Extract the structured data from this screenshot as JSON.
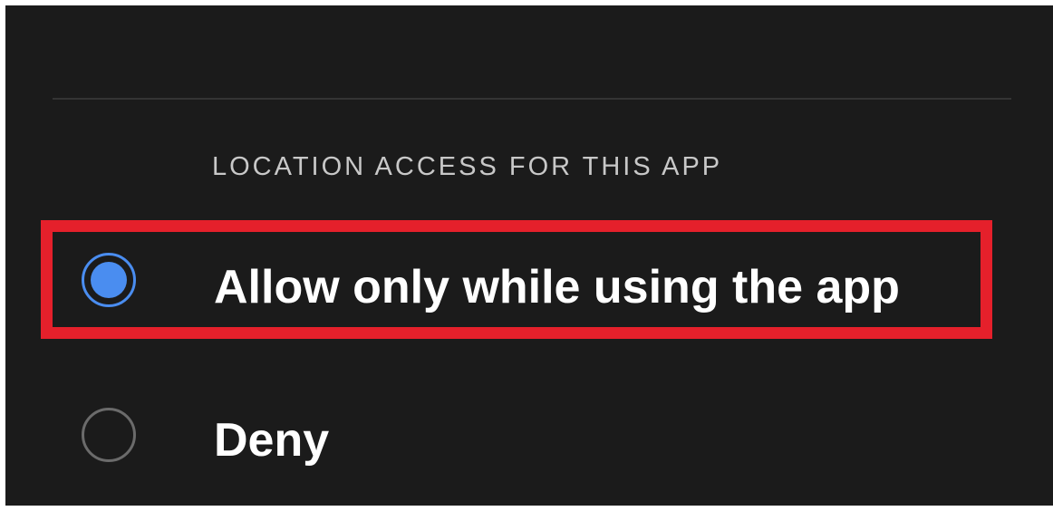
{
  "section": {
    "header": "LOCATION ACCESS FOR THIS APP"
  },
  "options": [
    {
      "label": "Allow only while using the app",
      "selected": true
    },
    {
      "label": "Deny",
      "selected": false
    }
  ],
  "colors": {
    "background": "#1b1b1b",
    "radio_selected": "#4a8df0",
    "radio_unselected": "#6b6b6b",
    "highlight": "#e5202b",
    "text": "#ffffff",
    "header_text": "#c8c8c8"
  }
}
